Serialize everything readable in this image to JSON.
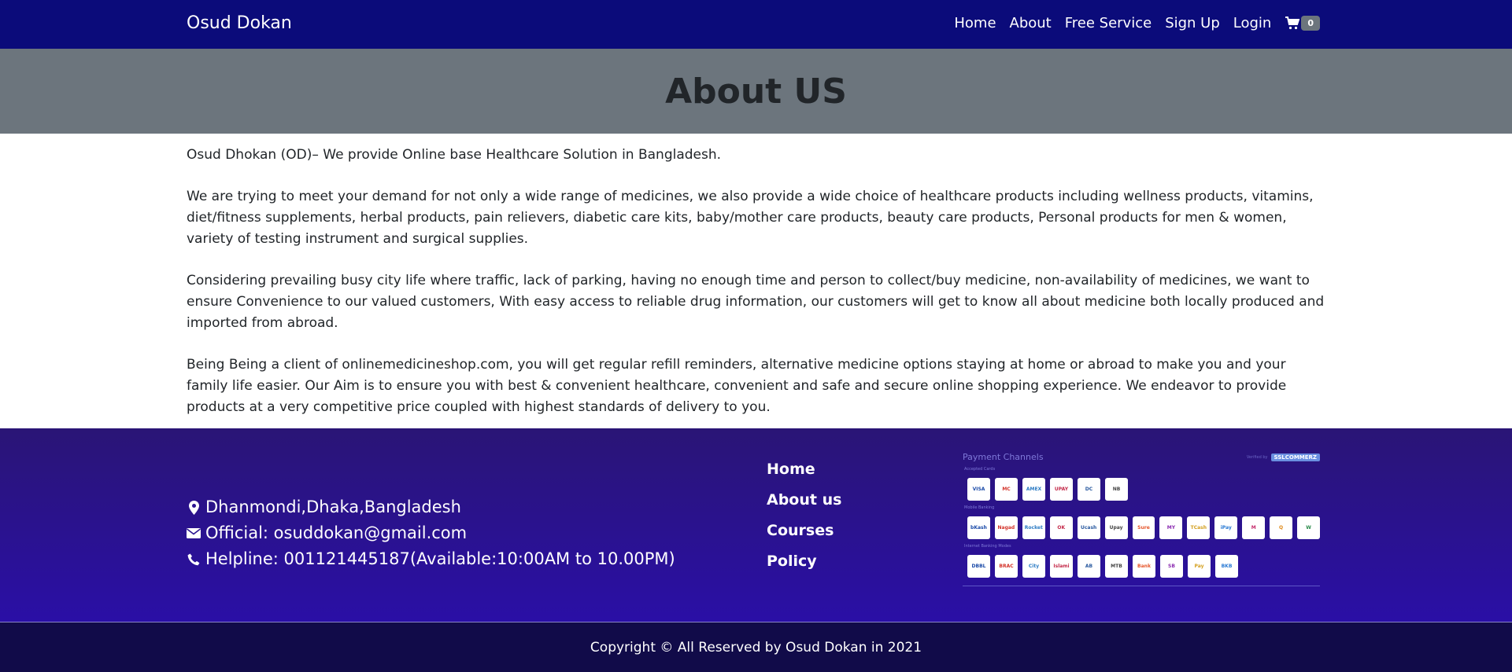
{
  "nav": {
    "brand": "Osud Dokan",
    "links": [
      "Home",
      "About",
      "Free Service",
      "Sign Up",
      "Login"
    ],
    "cart_count": "0"
  },
  "hero": {
    "title": "About US"
  },
  "about": {
    "paragraphs": [
      "Osud Dhokan (OD)– We provide Online base Healthcare Solution in Bangladesh.",
      "We are trying to meet your demand for not only a wide range of medicines, we also provide a wide choice of healthcare products including wellness products, vitamins, diet/fitness supplements, herbal products, pain relievers, diabetic care kits, baby/mother care products, beauty care products, Personal products for men & women, variety of testing instrument and surgical supplies.",
      "Considering prevailing busy city life where traffic, lack of parking, having no enough time and person to collect/buy medicine, non-availability of medicines, we want to ensure Convenience to our valued customers, With easy access to reliable drug information, our customers will get to know all about medicine both locally produced and imported from abroad.",
      "Being Being a client of onlinemedicineshop.com, you will get regular refill reminders, alternative medicine options staying at home or abroad to make you and your family life easier. Our Aim is to ensure you with best & convenient healthcare, convenient and safe and secure online shopping experience. We endeavor to provide products at a very competitive price coupled with highest standards of delivery to you."
    ]
  },
  "footer": {
    "address": "Dhanmondi,Dhaka,Bangladesh",
    "email": "Official: osuddokan@gmail.com",
    "helpline": "Helpline: 001121445187(Available:10:00AM to 10.00PM)",
    "links": [
      "Home",
      "About us",
      "Courses",
      "Policy"
    ],
    "payment": {
      "title": "Payment Channels",
      "verified_by": "Verified by",
      "provider": "SSLCOMMERZ",
      "cards_caption": "Accepted Cards",
      "cards": [
        "VISA",
        "MC",
        "AMEX",
        "UPAY",
        "DC",
        "NB"
      ],
      "mobile_caption": "Mobile Banking",
      "mobile": [
        "bKash",
        "Nagad",
        "Rocket",
        "OK",
        "Ucash",
        "Upay",
        "Sure",
        "MY",
        "TCash",
        "iPay",
        "M",
        "Q",
        "W"
      ],
      "internet_caption": "Internet Banking Modes",
      "internet": [
        "DBBL",
        "BRAC",
        "City",
        "Islami",
        "AB",
        "MTB",
        "Bank",
        "SB",
        "Pay",
        "BKB"
      ],
      "icon_color": "#ffffff"
    }
  },
  "copyright": "Copyright © All Reserved by Osud Dokan in 2021",
  "colors": {
    "nav_bg": "#0b0b7a",
    "hero_bg": "#6c757d",
    "footer_bg": "#2a0fa6",
    "bottom_bg": "#110b49"
  }
}
